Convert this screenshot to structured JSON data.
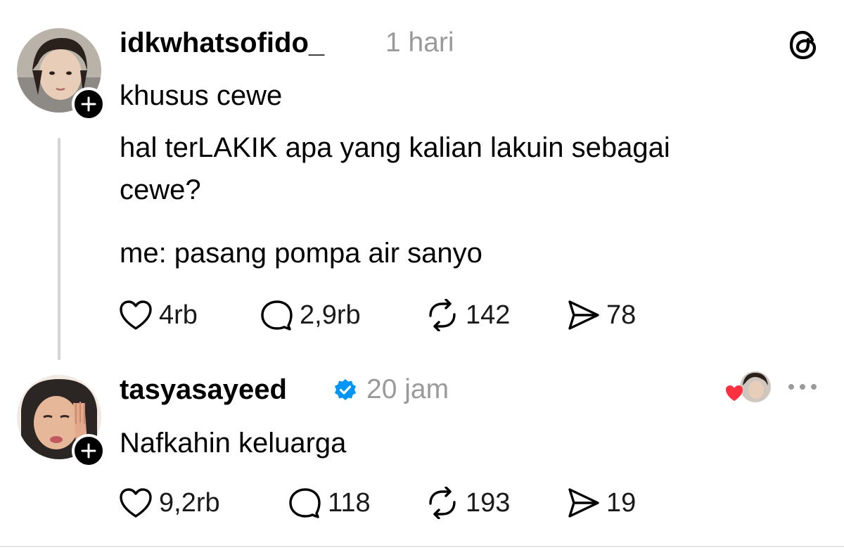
{
  "post": {
    "username": "idkwhatsofido_",
    "time": "1 hari",
    "lines": [
      "khusus cewe",
      "hal terLAKIK apa yang kalian lakuin sebagai",
      "cewe?",
      "me: pasang pompa air sanyo"
    ],
    "actions": {
      "likes": "4rb",
      "replies": "2,9rb",
      "reposts": "142",
      "shares": "78"
    },
    "brand_icon": "threads-logo-icon"
  },
  "reply": {
    "username": "tasyasayeed",
    "verified": true,
    "time": "20 jam",
    "text": "Nafkahin keluarga",
    "liked_by_author": true,
    "more_icon": "more-dots-icon",
    "actions": {
      "likes": "9,2rb",
      "replies": "118",
      "reposts": "193",
      "shares": "19"
    }
  },
  "colors": {
    "text": "#000000",
    "muted": "#9a9a9a",
    "verified": "#0095f6",
    "heart": "#ff3040",
    "thread_line": "#d4d4d4"
  }
}
